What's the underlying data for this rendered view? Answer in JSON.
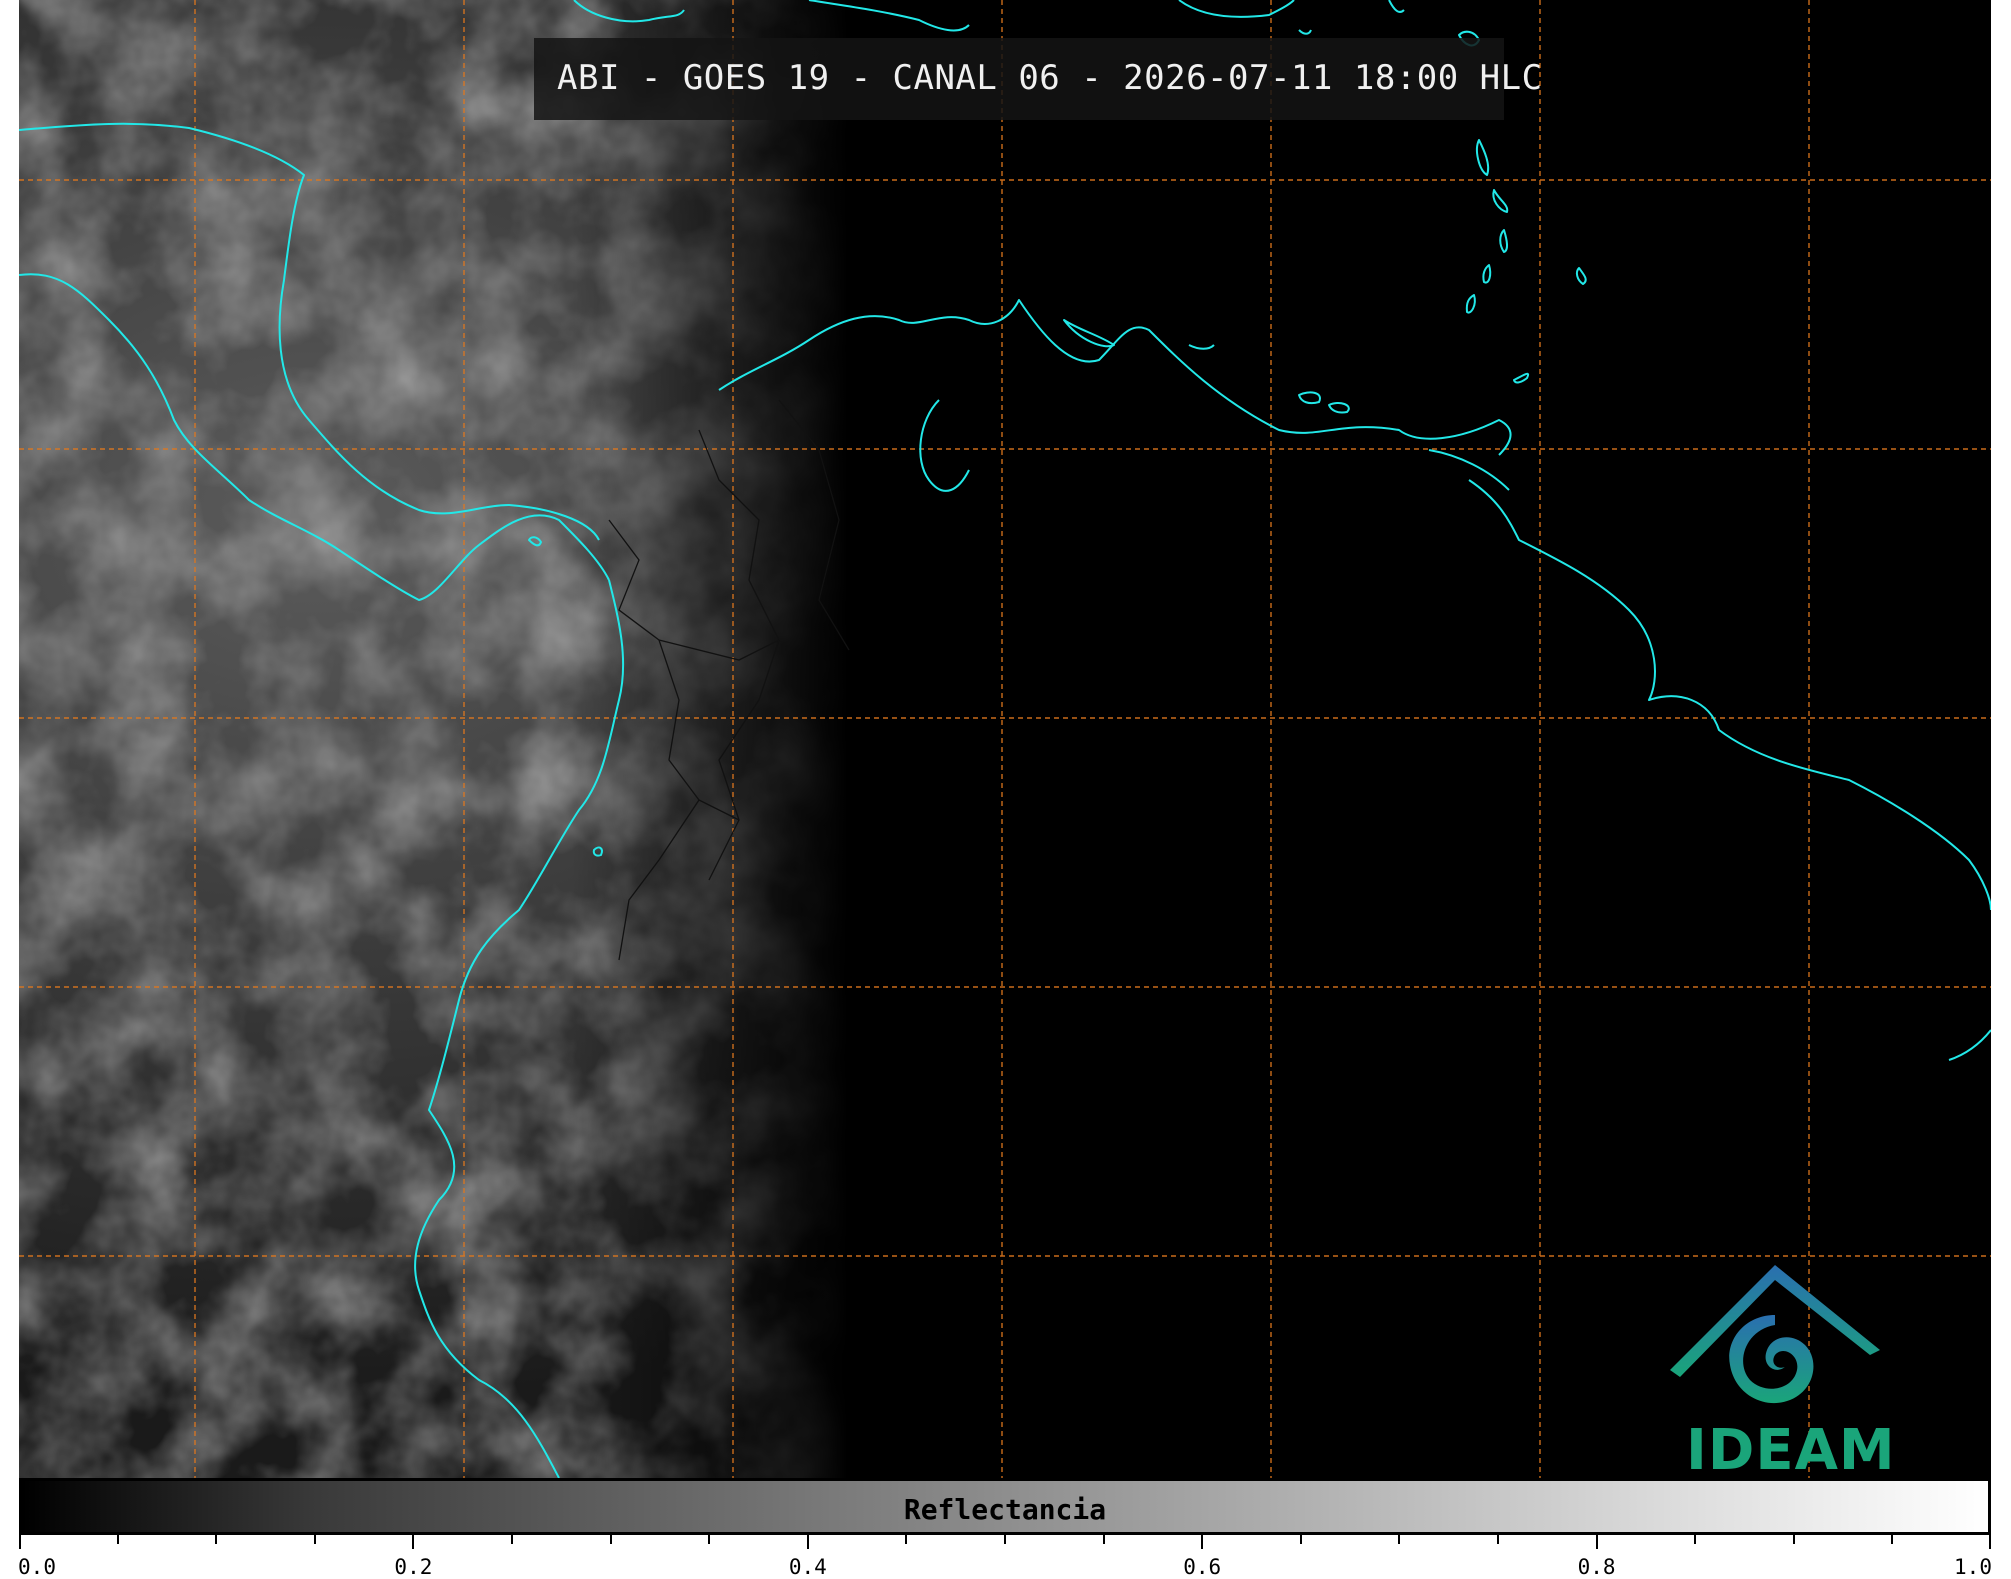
{
  "title": "ABI - GOES 19 - CANAL 06 - 2026-07-11 18:00 HLC",
  "colorbar": {
    "label": "Reflectancia",
    "ticks": [
      {
        "value": 0.0,
        "label": "0.0",
        "major": true
      },
      {
        "value": 0.05,
        "label": "",
        "major": false
      },
      {
        "value": 0.1,
        "label": "",
        "major": false
      },
      {
        "value": 0.15,
        "label": "",
        "major": false
      },
      {
        "value": 0.2,
        "label": "0.2",
        "major": true
      },
      {
        "value": 0.25,
        "label": "",
        "major": false
      },
      {
        "value": 0.3,
        "label": "",
        "major": false
      },
      {
        "value": 0.35,
        "label": "",
        "major": false
      },
      {
        "value": 0.4,
        "label": "0.4",
        "major": true
      },
      {
        "value": 0.45,
        "label": "",
        "major": false
      },
      {
        "value": 0.5,
        "label": "",
        "major": false
      },
      {
        "value": 0.55,
        "label": "",
        "major": false
      },
      {
        "value": 0.6,
        "label": "0.6",
        "major": true
      },
      {
        "value": 0.65,
        "label": "",
        "major": false
      },
      {
        "value": 0.7,
        "label": "",
        "major": false
      },
      {
        "value": 0.75,
        "label": "",
        "major": false
      },
      {
        "value": 0.8,
        "label": "0.8",
        "major": true
      },
      {
        "value": 0.85,
        "label": "",
        "major": false
      },
      {
        "value": 0.9,
        "label": "",
        "major": false
      },
      {
        "value": 0.95,
        "label": "",
        "major": false
      },
      {
        "value": 1.0,
        "label": "1.0",
        "major": true
      }
    ],
    "range": [
      0.0,
      1.0
    ]
  },
  "logo": {
    "text": "IDEAM"
  },
  "colors": {
    "coastline": "#22e8e8",
    "gridline": "#e0781e",
    "borders": "#111111",
    "logo_green": "#1aa57a",
    "logo_blue": "#2a6fb0"
  }
}
